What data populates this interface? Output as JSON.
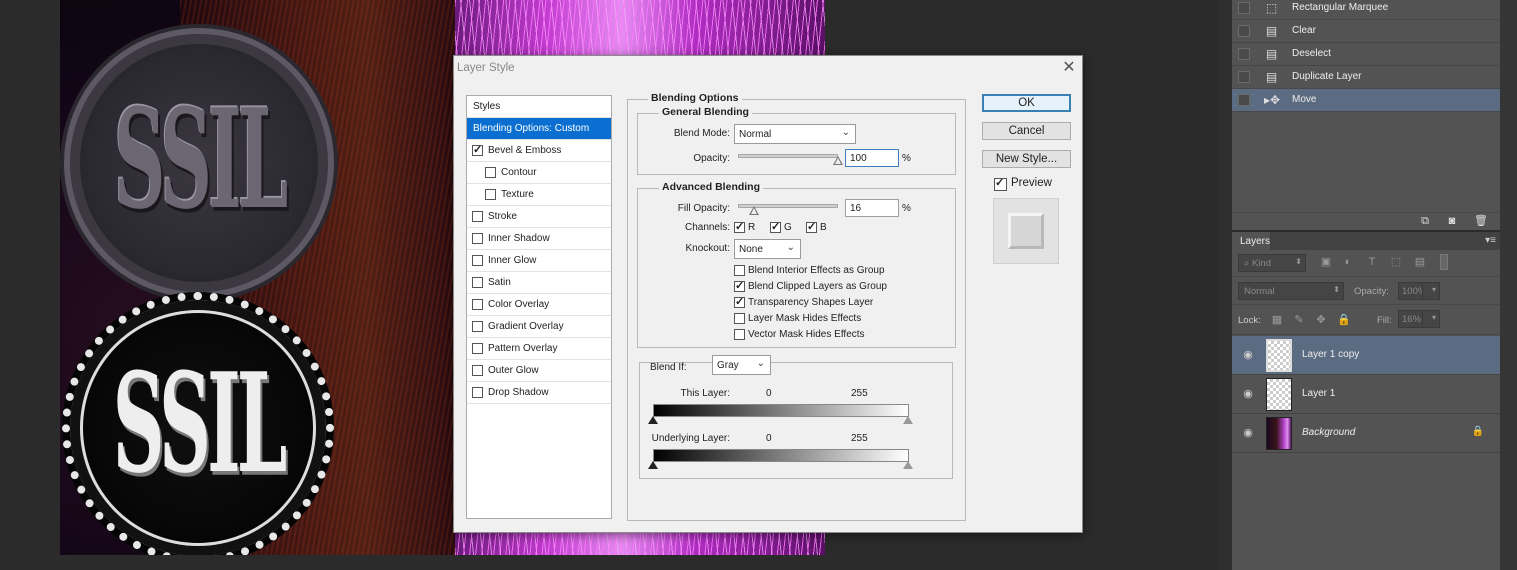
{
  "history": {
    "items": [
      {
        "label": "Rectangular Marquee",
        "icon": "marquee-icon"
      },
      {
        "label": "Clear",
        "icon": "document-icon"
      },
      {
        "label": "Deselect",
        "icon": "document-icon"
      },
      {
        "label": "Duplicate Layer",
        "icon": "document-icon"
      },
      {
        "label": "Move",
        "icon": "move-tool-icon",
        "selected": true
      }
    ]
  },
  "layers_panel": {
    "tab_label": "Layers",
    "kind_label": "Kind",
    "blend_mode": "Normal",
    "opacity_label": "Opacity:",
    "opacity_value": "100%",
    "lock_label": "Lock:",
    "fill_label": "Fill:",
    "fill_value": "16%",
    "layers": [
      {
        "name": "Layer 1 copy",
        "selected": true,
        "thumbnail": "transparent"
      },
      {
        "name": "Layer 1",
        "selected": false,
        "thumbnail": "transparent"
      },
      {
        "name": "Background",
        "selected": false,
        "thumbnail": "photo",
        "locked": true
      }
    ]
  },
  "canvas": {
    "seal_text_top": "SSIL",
    "seal_text_bottom": "SSIL"
  },
  "dialog": {
    "title": "Layer Style",
    "styles_header": "Styles",
    "styles": [
      {
        "label": "Blending Options: Custom",
        "selected": true,
        "checkbox": false
      },
      {
        "label": "Bevel & Emboss",
        "checked": true,
        "checkbox": true
      },
      {
        "label": "Contour",
        "checked": false,
        "checkbox": true,
        "indent": true
      },
      {
        "label": "Texture",
        "checked": false,
        "checkbox": true,
        "indent": true
      },
      {
        "label": "Stroke",
        "checked": false,
        "checkbox": true
      },
      {
        "label": "Inner Shadow",
        "checked": false,
        "checkbox": true
      },
      {
        "label": "Inner Glow",
        "checked": false,
        "checkbox": true
      },
      {
        "label": "Satin",
        "checked": false,
        "checkbox": true
      },
      {
        "label": "Color Overlay",
        "checked": false,
        "checkbox": true
      },
      {
        "label": "Gradient Overlay",
        "checked": false,
        "checkbox": true
      },
      {
        "label": "Pattern Overlay",
        "checked": false,
        "checkbox": true
      },
      {
        "label": "Outer Glow",
        "checked": false,
        "checkbox": true
      },
      {
        "label": "Drop Shadow",
        "checked": false,
        "checkbox": true
      }
    ],
    "blending_options_title": "Blending Options",
    "general": {
      "title": "General Blending",
      "blend_mode_label": "Blend Mode:",
      "blend_mode_value": "Normal",
      "opacity_label": "Opacity:",
      "opacity_value": "100",
      "opacity_level": 1.0,
      "percent": "%"
    },
    "advanced": {
      "title": "Advanced Blending",
      "fill_label": "Fill Opacity:",
      "fill_value": "16",
      "fill_level": 0.16,
      "percent": "%",
      "channels_label": "Channels:",
      "channels": [
        {
          "label": "R",
          "checked": true
        },
        {
          "label": "G",
          "checked": true
        },
        {
          "label": "B",
          "checked": true
        }
      ],
      "knockout_label": "Knockout:",
      "knockout_value": "None",
      "options": [
        {
          "label": "Blend Interior Effects as Group",
          "checked": false
        },
        {
          "label": "Blend Clipped Layers as Group",
          "checked": true
        },
        {
          "label": "Transparency Shapes Layer",
          "checked": true
        },
        {
          "label": "Layer Mask Hides Effects",
          "checked": false
        },
        {
          "label": "Vector Mask Hides Effects",
          "checked": false
        }
      ]
    },
    "blend_if": {
      "label": "Blend If:",
      "value": "Gray",
      "this_layer_label": "This Layer:",
      "this_layer_min": "0",
      "this_layer_max": "255",
      "underlying_label": "Underlying Layer:",
      "underlying_min": "0",
      "underlying_max": "255"
    },
    "buttons": {
      "ok": "OK",
      "cancel": "Cancel",
      "new_style": "New Style...",
      "preview_label": "Preview",
      "preview_checked": true
    }
  }
}
